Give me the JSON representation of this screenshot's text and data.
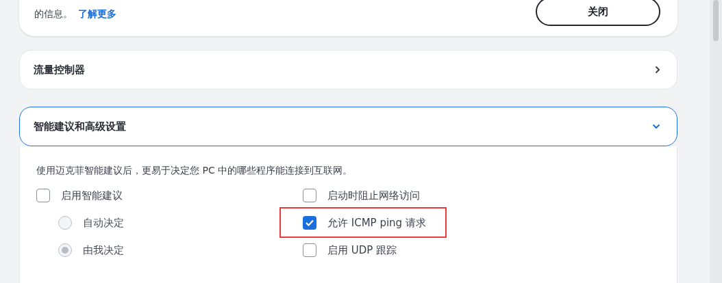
{
  "top_card": {
    "text": "的信息。",
    "link": "了解更多",
    "button": "关闭"
  },
  "sections": [
    {
      "title": "流量控制器",
      "expanded": false
    },
    {
      "title": "智能建议和高级设置",
      "expanded": true
    }
  ],
  "advanced": {
    "description": "使用迈克菲智能建议后，更易于决定您 PC 中的哪些程序能连接到互联网。",
    "left": [
      {
        "kind": "checkbox",
        "label": "启用智能建议",
        "checked": false
      },
      {
        "kind": "radio",
        "label": "自动决定",
        "selected": false,
        "disabled": true
      },
      {
        "kind": "radio",
        "label": "由我决定",
        "selected": true,
        "disabled": true
      }
    ],
    "right": [
      {
        "kind": "checkbox",
        "label": "启动时阻止网络访问",
        "checked": false,
        "highlighted": false
      },
      {
        "kind": "checkbox",
        "label": "允许 ICMP ping 请求",
        "checked": true,
        "highlighted": true
      },
      {
        "kind": "checkbox",
        "label": "启用 UDP 跟踪",
        "checked": false,
        "highlighted": false
      }
    ]
  }
}
